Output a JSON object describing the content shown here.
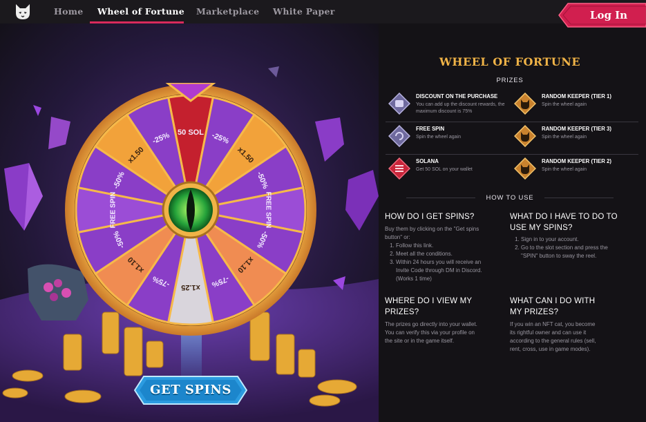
{
  "nav": {
    "items": [
      {
        "label": "Home"
      },
      {
        "label": "Wheel of Fortune"
      },
      {
        "label": "Marketplace"
      },
      {
        "label": "White Paper"
      }
    ],
    "login_label": "Log In"
  },
  "wheel": {
    "top_label": "50 SOL",
    "segment_labels": [
      "-25%",
      "x1.50",
      "-50%",
      "FREE SPIN",
      "-50%",
      "x1.10",
      "-75%",
      "x1.25",
      "-75%",
      "x1.10",
      "-50%",
      "FREE SPIN",
      "-50%",
      "x1.50",
      "-25%"
    ],
    "get_spins_label": "GET SPINS"
  },
  "panel": {
    "title": "WHEEL OF FORTUNE",
    "prizes_heading": "PRIZES",
    "prizes": [
      {
        "name": "DISCOUNT ON THE PURCHASE",
        "desc": "You can add up the discount rewards, the maximum discount is 75%",
        "icon": "discount-icon",
        "color": "#6f6a9e"
      },
      {
        "name": "RANDOM KEEPER (TIER 1)",
        "desc": "Spin the wheel again",
        "icon": "keeper-tier1-icon",
        "color": "#c9822e"
      },
      {
        "name": "FREE SPIN",
        "desc": "Spin the wheel again",
        "icon": "free-spin-icon",
        "color": "#6f6a9e"
      },
      {
        "name": "RANDOM KEEPER (TIER 3)",
        "desc": "Spin the wheel again",
        "icon": "keeper-tier3-icon",
        "color": "#c9822e"
      },
      {
        "name": "SOLANA",
        "desc": "Get 50 SOL on your wallet",
        "icon": "solana-icon",
        "color": "#c8253a"
      },
      {
        "name": "RANDOM KEEPER (TIER 2)",
        "desc": "Spin the wheel again",
        "icon": "keeper-tier2-icon",
        "color": "#c9822e"
      }
    ],
    "how_heading": "HOW TO USE",
    "faq": {
      "get_spins": {
        "question": "HOW DO I GET SPINS?",
        "intro": "Buy them by clicking on the \"Get spins button\" or:",
        "steps": [
          "Follow this link.",
          "Meet all the conditions.",
          "Within 24 hours you will receive an Invite Code through DM in Discord. (Works 1 time)"
        ]
      },
      "use_spins": {
        "question": "WHAT DO I HAVE TO DO TO USE MY SPINS?",
        "steps": [
          "Sign in to your account.",
          "Go to the slot section and press the \"SPIN\" button to sway the reel."
        ]
      },
      "view_prizes": {
        "question": "WHERE DO I VIEW MY PRIZES?",
        "answer": "The prizes go directly into your wallet. You can verify this via your profile on the site or in the game itself."
      },
      "do_prizes": {
        "question": "WHAT CAN I DO WITH MY PRIZES?",
        "answer": "If you win an NFT cat, you become its rightful owner and can use it according to the general rules (sell, rent, cross, use in game modes)."
      }
    }
  }
}
